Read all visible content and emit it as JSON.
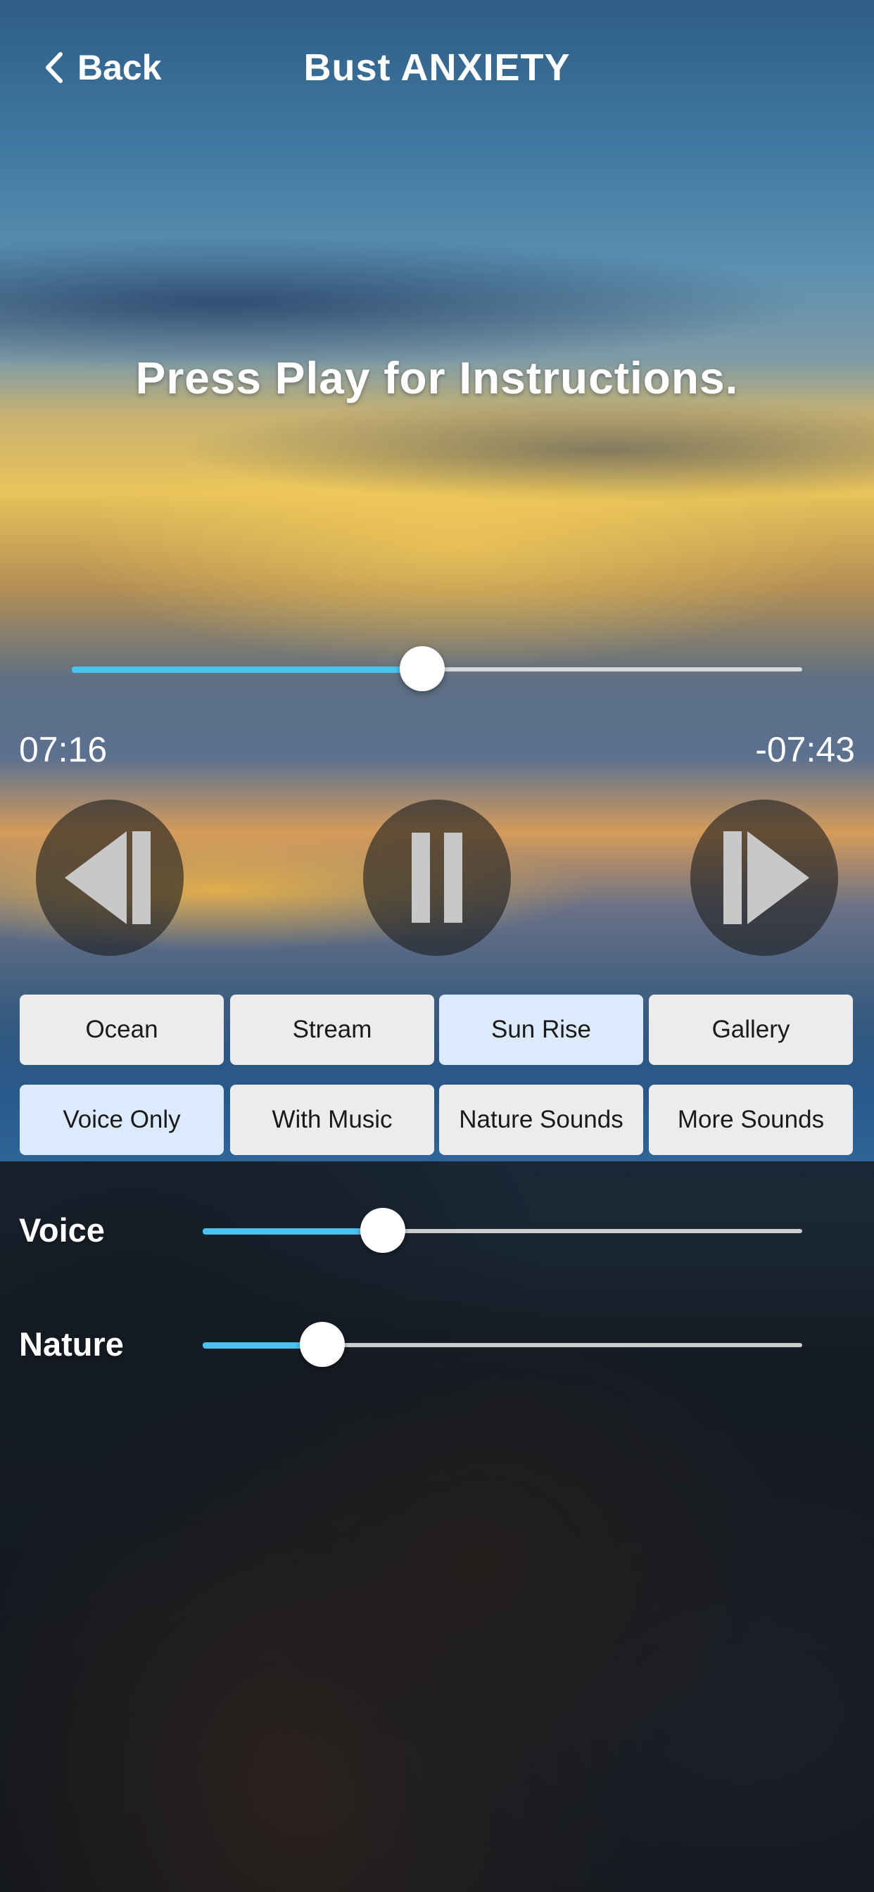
{
  "header": {
    "back_label": "Back",
    "title": "Bust ANXIETY"
  },
  "instruction": "Press Play for Instructions.",
  "playback": {
    "progress": 0.48,
    "elapsed": "07:16",
    "remaining": "-07:43"
  },
  "transport": {
    "rewind_icon": "rewind-icon",
    "pause_icon": "pause-icon",
    "forward_icon": "forward-icon"
  },
  "scenes": [
    {
      "label": "Ocean",
      "selected": false
    },
    {
      "label": "Stream",
      "selected": false
    },
    {
      "label": "Sun Rise",
      "selected": true
    },
    {
      "label": "Gallery",
      "selected": false
    }
  ],
  "modes": [
    {
      "label": "Voice Only",
      "selected": true
    },
    {
      "label": "With Music",
      "selected": false
    },
    {
      "label": "Nature Sounds",
      "selected": false
    },
    {
      "label": "More Sounds",
      "selected": false
    }
  ],
  "mixer": {
    "voice_label": "Voice",
    "voice_level": 0.3,
    "nature_label": "Nature",
    "nature_level": 0.2
  },
  "colors": {
    "accent": "#48c3f0",
    "button_bg": "#ececec",
    "button_selected_bg": "#dbeafc"
  }
}
